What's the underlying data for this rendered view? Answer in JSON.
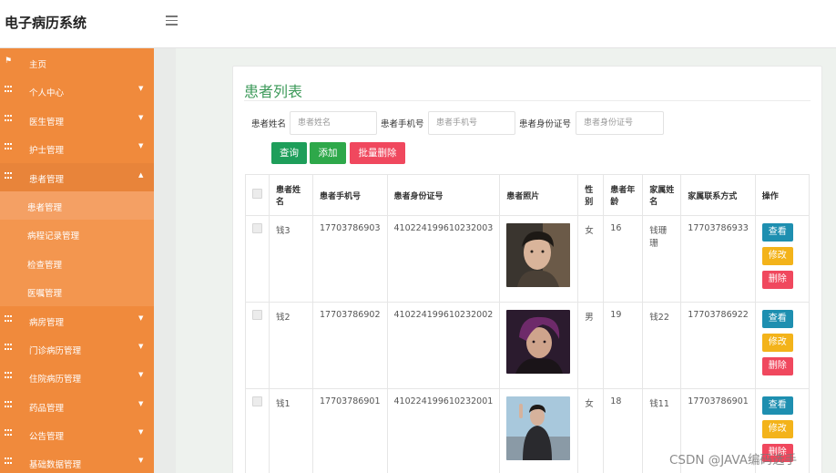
{
  "app": {
    "title": "电子病历系统"
  },
  "sidebar": {
    "items": [
      {
        "label": "主页",
        "icon": "flag-icon",
        "has_chevron": false
      },
      {
        "label": "个人中心",
        "icon": "grid-icon",
        "has_chevron": true
      },
      {
        "label": "医生管理",
        "icon": "grid-icon",
        "has_chevron": true
      },
      {
        "label": "护士管理",
        "icon": "grid-icon",
        "has_chevron": true
      },
      {
        "label": "患者管理",
        "icon": "grid-icon",
        "has_chevron": true,
        "expanded": true
      },
      {
        "label": "患者管理",
        "sub": true,
        "active": true
      },
      {
        "label": "病程记录管理",
        "sub": true
      },
      {
        "label": "检查管理",
        "sub": true
      },
      {
        "label": "医嘱管理",
        "sub": true
      },
      {
        "label": "病房管理",
        "icon": "grid-icon",
        "has_chevron": true
      },
      {
        "label": "门诊病历管理",
        "icon": "grid-icon",
        "has_chevron": true
      },
      {
        "label": "住院病历管理",
        "icon": "grid-icon",
        "has_chevron": true
      },
      {
        "label": "药品管理",
        "icon": "grid-icon",
        "has_chevron": true
      },
      {
        "label": "公告管理",
        "icon": "grid-icon",
        "has_chevron": true
      },
      {
        "label": "基础数据管理",
        "icon": "grid-icon",
        "has_chevron": true
      }
    ]
  },
  "main": {
    "title": "患者列表",
    "filters": {
      "name": {
        "label": "患者姓名",
        "placeholder": "患者姓名"
      },
      "phone": {
        "label": "患者手机号",
        "placeholder": "患者手机号"
      },
      "idcard": {
        "label": "患者身份证号",
        "placeholder": "患者身份证号"
      }
    },
    "buttons": {
      "query": "查询",
      "add": "添加",
      "batch_delete": "批量删除"
    },
    "table": {
      "headers": {
        "name": "患者姓名",
        "phone": "患者手机号",
        "idcard": "患者身份证号",
        "photo": "患者照片",
        "gender": "性别",
        "age": "患者年龄",
        "family_name": "家属姓名",
        "family_phone": "家属联系方式",
        "actions": "操作"
      },
      "rows": [
        {
          "name": "钱3",
          "phone": "17703786903",
          "idcard": "410224199610232003",
          "gender": "女",
          "age": "16",
          "family_name": "钱珊珊",
          "family_phone": "17703786933"
        },
        {
          "name": "钱2",
          "phone": "17703786902",
          "idcard": "410224199610232002",
          "gender": "男",
          "age": "19",
          "family_name": "钱22",
          "family_phone": "17703786922"
        },
        {
          "name": "钱1",
          "phone": "17703786901",
          "idcard": "410224199610232001",
          "gender": "女",
          "age": "18",
          "family_name": "钱11",
          "family_phone": "17703786901"
        }
      ],
      "actions": {
        "view": "查看",
        "edit": "修改",
        "delete": "删除"
      }
    }
  },
  "watermark": "CSDN @JAVA编码选手",
  "colors": {
    "sidebar": "#f08a3c",
    "title": "#3d9a5a",
    "view": "#1e8fb0",
    "edit": "#f3b31a",
    "delete": "#f0485e",
    "query": "#1e9e5a",
    "add": "#2ea84a"
  }
}
